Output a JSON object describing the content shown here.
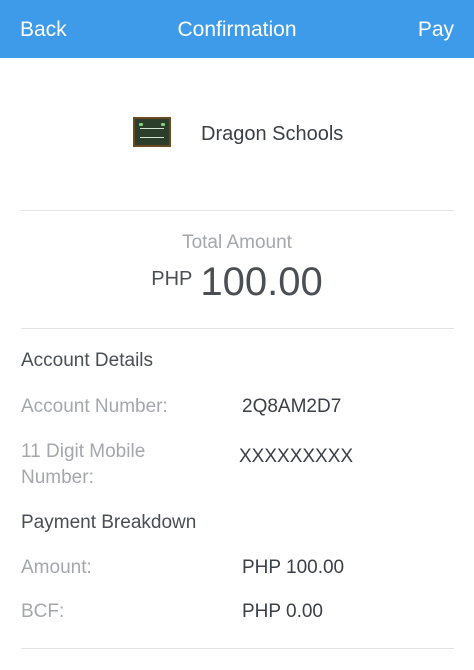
{
  "nav": {
    "back_label": "Back",
    "title": "Confirmation",
    "pay_label": "Pay"
  },
  "merchant": {
    "name": "Dragon Schools",
    "logo_icon": "chalkboard-logo-icon"
  },
  "total": {
    "label": "Total Amount",
    "currency": "PHP",
    "amount": "100.00"
  },
  "account_details": {
    "title": "Account Details",
    "account_number_label": "Account Number:",
    "account_number_value": "2Q8AM2D7",
    "mobile_label_line1": "11 Digit Mobile",
    "mobile_label_line2": "Number:",
    "mobile_value": "XXXXXXXXX"
  },
  "payment_breakdown": {
    "title": "Payment Breakdown",
    "amount_label": "Amount:",
    "amount_value": "PHP 100.00",
    "bcf_label": "BCF:",
    "bcf_value": "PHP 0.00"
  },
  "colors": {
    "nav_background": "#3d9be9",
    "primary_text": "#3b3f46",
    "secondary_text": "#a4a7ab",
    "divider": "#e3e3e3"
  }
}
